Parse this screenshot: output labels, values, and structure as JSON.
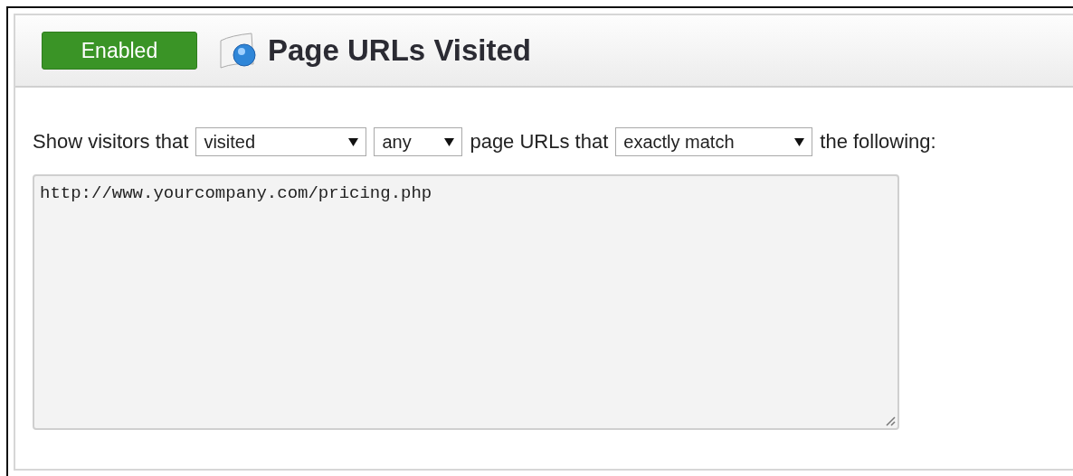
{
  "header": {
    "status": {
      "label": "Enabled",
      "on": true
    },
    "title": "Page URLs Visited"
  },
  "filter": {
    "parts": [
      {
        "kind": "text",
        "text": "Show visitors that"
      },
      {
        "kind": "select",
        "value": "visited"
      },
      {
        "kind": "select",
        "value": "any"
      },
      {
        "kind": "text",
        "text": "page URLs that"
      },
      {
        "kind": "select",
        "value": "exactly match"
      },
      {
        "kind": "text",
        "text": "the following:"
      }
    ]
  },
  "urls": {
    "value": "http://www.yourcompany.com/pricing.php"
  }
}
